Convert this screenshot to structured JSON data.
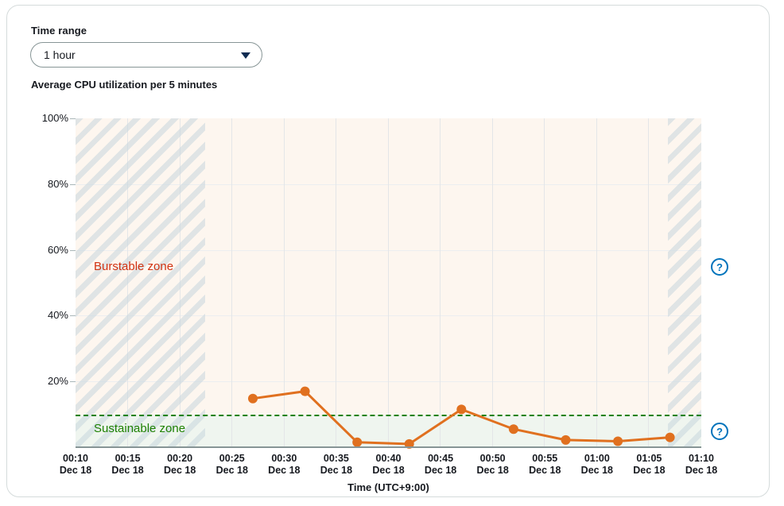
{
  "panel": {
    "time_range_label": "Time range",
    "time_range_value": "1 hour",
    "time_range_options": [
      "1 hour"
    ],
    "chart_title": "Average CPU utilization per 5 minutes",
    "dropdown_icon": "chevron-down-icon",
    "help_icon": "help-circle-icon"
  },
  "chart_data": {
    "type": "line",
    "title": "Average CPU utilization per 5 minutes",
    "xlabel": "Time (UTC+9:00)",
    "ylabel": "",
    "ylim": [
      0,
      100
    ],
    "y_ticks": [
      "20%",
      "40%",
      "60%",
      "80%",
      "100%"
    ],
    "y_tick_values": [
      20,
      40,
      60,
      80,
      100
    ],
    "grid": true,
    "legend": "none",
    "x_tick_times": [
      "00:10",
      "00:15",
      "00:20",
      "00:25",
      "00:30",
      "00:35",
      "00:40",
      "00:45",
      "00:50",
      "00:55",
      "01:00",
      "01:05",
      "01:10"
    ],
    "x_tick_dates": [
      "Dec 18",
      "Dec 18",
      "Dec 18",
      "Dec 18",
      "Dec 18",
      "Dec 18",
      "Dec 18",
      "Dec 18",
      "Dec 18",
      "Dec 18",
      "Dec 18",
      "Dec 18",
      "Dec 18"
    ],
    "series": [
      {
        "name": "Average CPU utilization",
        "color": "#e0701f",
        "x": [
          "00:27",
          "00:32",
          "00:37",
          "00:42",
          "00:47",
          "00:52",
          "00:57",
          "01:02",
          "01:07"
        ],
        "values": [
          14.8,
          17.0,
          1.5,
          1.0,
          11.5,
          5.5,
          2.2,
          1.8,
          3.0
        ]
      }
    ],
    "annotations": [
      {
        "name": "burstable-zone",
        "text": "Burstable zone",
        "color": "#d13212",
        "range": [
          10,
          100
        ]
      },
      {
        "name": "sustainable-zone",
        "text": "Sustainable zone",
        "color": "#1d8102",
        "range": [
          0,
          10
        ]
      },
      {
        "name": "threshold-line",
        "value": 10,
        "style": "dashed",
        "color": "#1d8102"
      },
      {
        "name": "no-data-region-left",
        "from": "00:10",
        "to": "00:25"
      },
      {
        "name": "no-data-region-right",
        "from": "01:08",
        "to": "01:10"
      }
    ]
  }
}
